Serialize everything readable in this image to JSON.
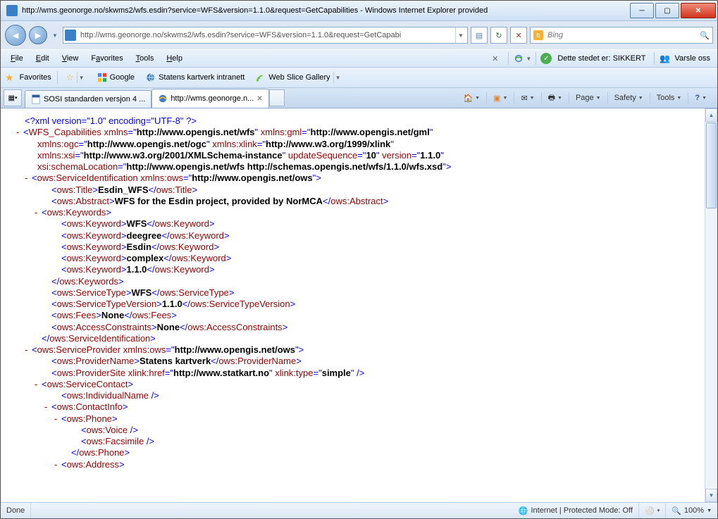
{
  "window": {
    "title": "http://wms.geonorge.no/skwms2/wfs.esdin?service=WFS&version=1.1.0&request=GetCapabilities - Windows Internet Explorer provided"
  },
  "address": {
    "url": "http://wms.geonorge.no/skwms2/wfs.esdin?service=WFS&version=1.1.0&request=GetCapabi"
  },
  "search": {
    "placeholder": "Bing"
  },
  "menu": {
    "file": "File",
    "edit": "Edit",
    "view": "View",
    "favorites": "Favorites",
    "tools": "Tools",
    "help": "Help",
    "security_text": "Dette stedet er: SIKKERT",
    "notify": "Varsle oss"
  },
  "favbar": {
    "favorites": "Favorites",
    "google": "Google",
    "statkart": "Statens kartverk intranett",
    "webslice": "Web Slice Gallery"
  },
  "tabs": {
    "tab1": "SOSI standarden versjon 4 ...",
    "tab2": "http://wms.geonorge.n..."
  },
  "cmd": {
    "page": "Page",
    "safety": "Safety",
    "tools": "Tools"
  },
  "status": {
    "done": "Done",
    "zone": "Internet | Protected Mode: Off",
    "zoom": "100%"
  },
  "xml": {
    "pi": "<?xml version=\"1.0\" encoding=\"UTF-8\" ?>",
    "root": {
      "name": "WFS_Capabilities",
      "xmlns": "http://www.opengis.net/wfs",
      "xmlns_gml": "http://www.opengis.net/gml",
      "xmlns_ogc": "http://www.opengis.net/ogc",
      "xmlns_xlink": "http://www.w3.org/1999/xlink",
      "xmlns_xsi": "http://www.w3.org/2001/XMLSchema-instance",
      "updateSequence": "10",
      "version": "1.1.0",
      "schemaLocation": "http://www.opengis.net/wfs http://schemas.opengis.net/wfs/1.1.0/wfs.xsd"
    },
    "si_ns": "http://www.opengis.net/ows",
    "title": "Esdin_WFS",
    "abstract": "WFS for the Esdin project, provided by NorMCA",
    "keywords": [
      "WFS",
      "deegree",
      "Esdin",
      "complex",
      "1.1.0"
    ],
    "serviceType": "WFS",
    "serviceTypeVersion": "1.1.0",
    "fees": "None",
    "accessConstraints": "None",
    "sp_ns": "http://www.opengis.net/ows",
    "providerName": "Statens kartverk",
    "providerSite_href": "http://www.statkart.no",
    "providerSite_type": "simple"
  }
}
